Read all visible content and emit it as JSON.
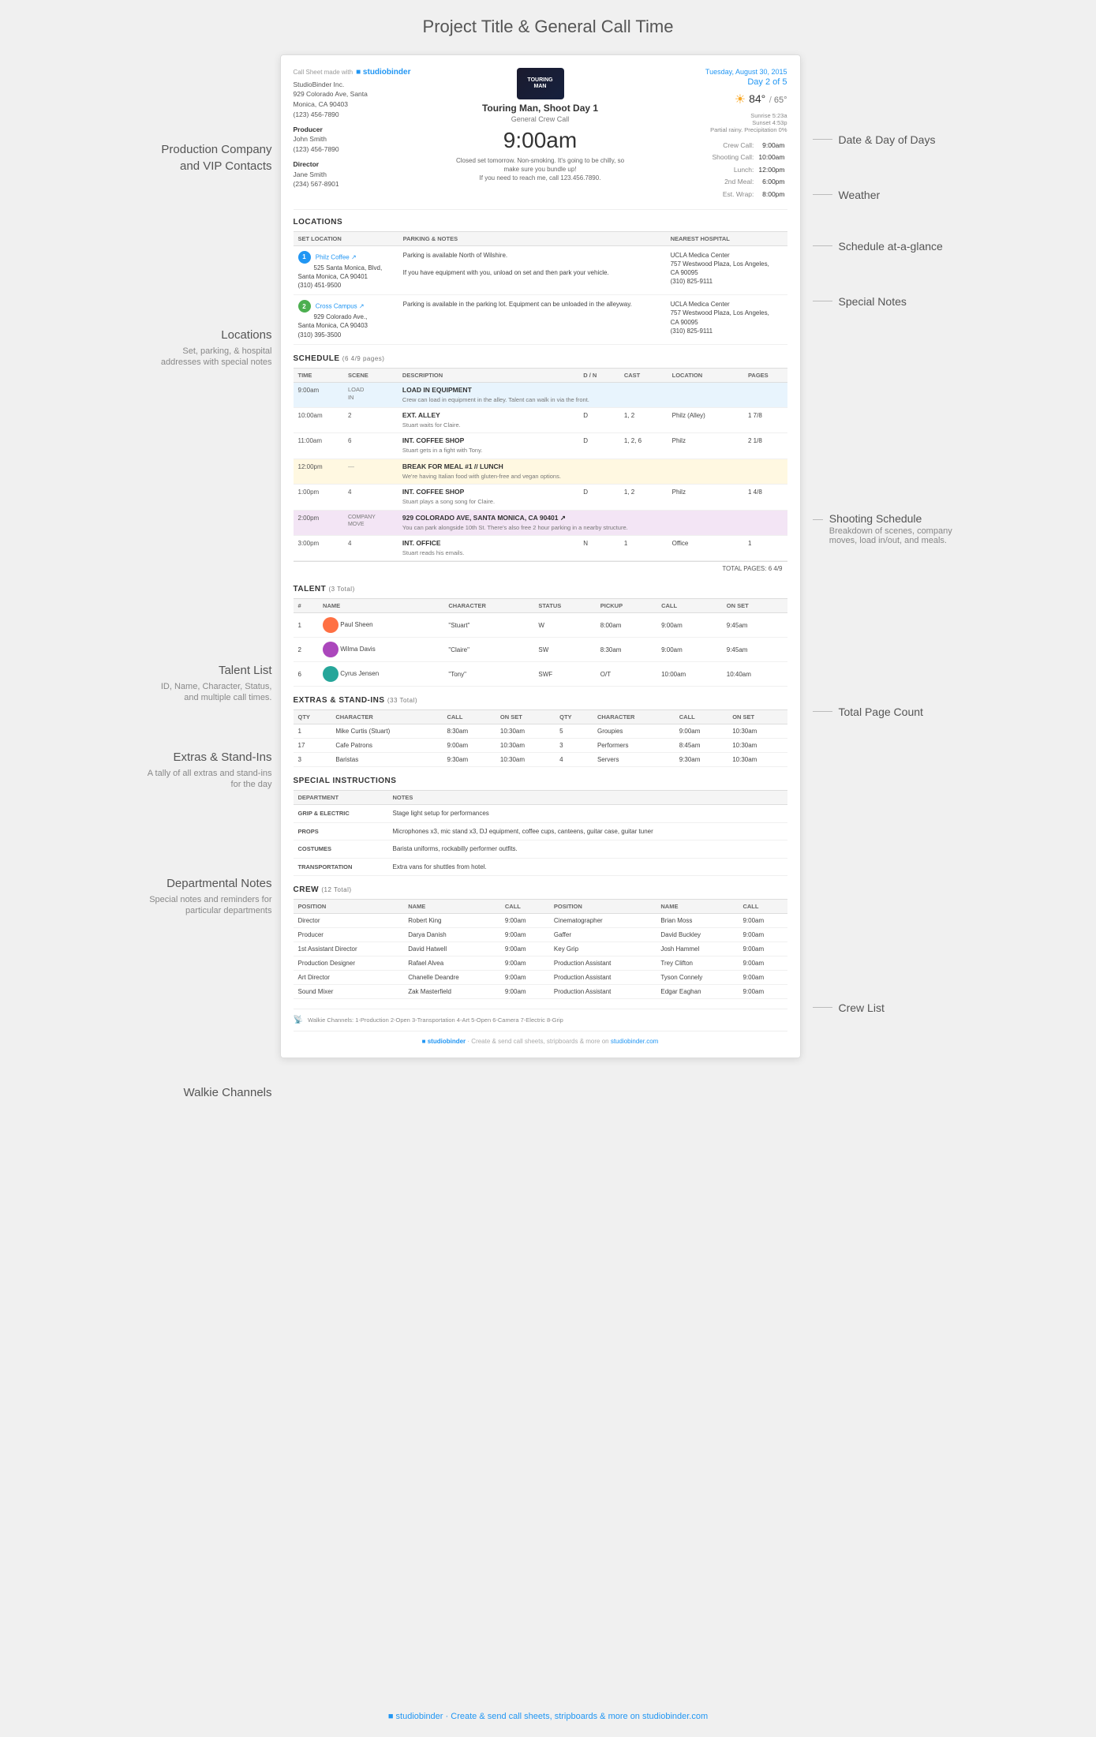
{
  "page": {
    "title": "Project Title & General Call Time",
    "footer": "studiobinder · Create & send call sheets, stripboards & more on studiobinder.com"
  },
  "document": {
    "sb_label": "Call Sheet made with",
    "sb_brand": "studiobinder",
    "company": {
      "name": "StudioBinder Inc.",
      "address1": "929 Colorado Ave, Santa",
      "address2": "Monica, CA 90403",
      "phone": "(123) 456-7890"
    },
    "producer": {
      "label": "Producer",
      "name": "John Smith",
      "phone": "(123) 456-7890"
    },
    "director": {
      "label": "Director",
      "name": "Jane Smith",
      "phone": "(234) 567-8901"
    },
    "tour_logo": "TOURING MAN",
    "show_title": "Touring Man, Shoot Day 1",
    "general_call_label": "General Crew Call",
    "call_time": "9:00am",
    "closed_set_note": "Closed set tomorrow. Non-smoking. It's going to be chilly, so make sure you bundle up!\nIf you need to reach me, call 123.456.7890.",
    "date": "Tuesday, August 30, 2015",
    "day_of_days": "Day 2 of 5",
    "weather": {
      "temp_high": "84°",
      "temp_low": "65°",
      "sunrise": "Sunrise 5:23a",
      "sunset": "Sunset 4:53p",
      "precip": "Partial rainy. Precipitation 0%"
    },
    "schedule_glance": [
      {
        "label": "Crew Call:",
        "time": "9:00am"
      },
      {
        "label": "Shooting Call:",
        "time": "10:00am"
      },
      {
        "label": "Lunch:",
        "time": "12:00pm"
      },
      {
        "label": "2nd Meal:",
        "time": "6:00pm"
      },
      {
        "label": "Est. Wrap:",
        "time": "8:00pm"
      }
    ],
    "locations": {
      "section_title": "LOCATIONS",
      "headers": [
        "SET LOCATION",
        "PARKING & NOTES",
        "NEAREST HOSPITAL"
      ],
      "rows": [
        {
          "number": "1",
          "name": "Philz Coffee",
          "address": "525 Santa Monica, Blvd, Santa Monica, CA 90401\n(310) 451-9500",
          "parking": "Parking is available North of Wilshire.\n\nIf you have equipment with you, unload on set and then park your vehicle.",
          "hospital": "UCLA Medica Center\n757 Westwood Plaza, Los Angeles, CA 90095\n(310) 825-9111"
        },
        {
          "number": "2",
          "name": "Cross Campus",
          "address": "929 Colorado Ave., Santa Monica, CA 90403\n(310) 395-3500",
          "parking": "Parking is available in the parking lot. Equipment can be unloaded in the alleyway.",
          "hospital": "UCLA Medica Center\n757 Westwood Plaza, Los Angeles, CA 90095\n(310) 825-9111"
        }
      ]
    },
    "schedule": {
      "section_title": "SCHEDULE",
      "subtitle": "(6 4/9 pages)",
      "headers": [
        "TIME",
        "SCENE",
        "DESCRIPTION",
        "D/N",
        "CAST",
        "LOCATION",
        "PAGES"
      ],
      "rows": [
        {
          "time": "9:00am",
          "scene": "LOAD IN",
          "title": "LOAD IN EQUIPMENT",
          "desc": "Crew can load in equipment in the alley. Talent can walk in via the front.",
          "dn": "",
          "cast": "",
          "location": "",
          "pages": "",
          "type": "load"
        },
        {
          "time": "10:00am",
          "scene": "2",
          "title": "EXT. ALLEY",
          "desc": "Stuart waits for Claire.",
          "dn": "D",
          "cast": "1, 2",
          "location": "Philz (Alley)",
          "pages": "1 7/8",
          "type": "normal"
        },
        {
          "time": "11:00am",
          "scene": "6",
          "title": "INT. COFFEE SHOP",
          "desc": "Stuart gets in a fight with Tony.",
          "dn": "D",
          "cast": "1, 2, 6",
          "location": "Philz",
          "pages": "2 1/8",
          "type": "normal"
        },
        {
          "time": "12:00pm",
          "scene": "—",
          "title": "BREAK FOR MEAL #1 // LUNCH",
          "desc": "We're having Italian food with gluten-free and vegan options.",
          "dn": "",
          "cast": "",
          "location": "",
          "pages": "",
          "type": "meal"
        },
        {
          "time": "1:00pm",
          "scene": "4",
          "title": "INT. COFFEE SHOP",
          "desc": "Stuart plays a song song for Claire.",
          "dn": "D",
          "cast": "1, 2",
          "location": "Philz",
          "pages": "1 4/8",
          "type": "normal"
        },
        {
          "time": "2:00pm",
          "scene": "COMPANY MOVE",
          "title": "929 COLORADO AVE, SANTA MONICA, CA 90401",
          "desc": "You can park alongside 10th St. There's also free 2 hour parking in a nearby structure.",
          "dn": "",
          "cast": "",
          "location": "",
          "pages": "",
          "type": "move"
        },
        {
          "time": "3:00pm",
          "scene": "4",
          "title": "INT. OFFICE",
          "desc": "Stuart reads his emails.",
          "dn": "N",
          "cast": "1",
          "location": "Office",
          "pages": "1",
          "type": "normal"
        }
      ],
      "total_pages": "TOTAL PAGES: 6 4/9"
    },
    "talent": {
      "section_title": "TALENT",
      "subtitle": "(3 Total)",
      "headers": [
        "#",
        "NAME",
        "CHARACTER",
        "STATUS",
        "PICKUP",
        "CALL",
        "ON SET"
      ],
      "rows": [
        {
          "num": "1",
          "name": "Paul Sheen",
          "character": "\"Stuart\"",
          "status": "W",
          "pickup": "8:00am",
          "call": "9:00am",
          "onset": "9:45am",
          "avatar": "1"
        },
        {
          "num": "2",
          "name": "Wilma Davis",
          "character": "\"Claire\"",
          "status": "SW",
          "pickup": "8:30am",
          "call": "9:00am",
          "onset": "9:45am",
          "avatar": "2"
        },
        {
          "num": "6",
          "name": "Cyrus Jensen",
          "character": "\"Tony\"",
          "status": "SWF",
          "pickup": "O/T",
          "call": "10:00am",
          "onset": "10:40am",
          "avatar": "3"
        }
      ]
    },
    "extras": {
      "section_title": "EXTRAS & STAND-INS",
      "subtitle": "(33 Total)",
      "headers": [
        "QTY",
        "CHARACTER",
        "CALL",
        "ON SET",
        "QTY",
        "CHARACTER",
        "CALL",
        "ON SET"
      ],
      "rows": [
        {
          "qty1": "1",
          "char1": "Mike Curtis (Stuart)",
          "call1": "8:30am",
          "onset1": "10:30am",
          "qty2": "5",
          "char2": "Groupies",
          "call2": "9:00am",
          "onset2": "10:30am"
        },
        {
          "qty1": "17",
          "char1": "Cafe Patrons",
          "call1": "9:00am",
          "onset1": "10:30am",
          "qty2": "3",
          "char2": "Performers",
          "call2": "8:45am",
          "onset2": "10:30am"
        },
        {
          "qty1": "3",
          "char1": "Baristas",
          "call1": "9:30am",
          "onset1": "10:30am",
          "qty2": "4",
          "char2": "Servers",
          "call2": "9:30am",
          "onset2": "10:30am"
        }
      ]
    },
    "special_instructions": {
      "section_title": "SPECIAL INSTRUCTIONS",
      "headers": [
        "DEPARTMENT",
        "NOTES"
      ],
      "rows": [
        {
          "dept": "GRIP & ELECTRIC",
          "notes": "Stage light setup for performances"
        },
        {
          "dept": "PROPS",
          "notes": "Microphones x3, mic stand x3, DJ equipment, coffee cups, canteens, guitar case, guitar tuner"
        },
        {
          "dept": "COSTUMES",
          "notes": "Barista uniforms, rockabilly performer outfits."
        },
        {
          "dept": "TRANSPORTATION",
          "notes": "Extra vans for shuttles from hotel."
        }
      ]
    },
    "crew": {
      "section_title": "CREW",
      "subtitle": "(12 Total)",
      "headers": [
        "POSITION",
        "NAME",
        "CALL",
        "POSITION",
        "NAME",
        "CALL"
      ],
      "rows": [
        {
          "pos1": "Director",
          "name1": "Robert King",
          "call1": "9:00am",
          "pos2": "Cinematographer",
          "name2": "Brian Moss",
          "call2": "9:00am"
        },
        {
          "pos1": "Producer",
          "name1": "Darya Danish",
          "call1": "9:00am",
          "pos2": "Gaffer",
          "name2": "David Buckley",
          "call2": "9:00am"
        },
        {
          "pos1": "1st Assistant Director",
          "name1": "David Hatwell",
          "call1": "9:00am",
          "pos2": "Key Grip",
          "name2": "Josh Hammel",
          "call2": "9:00am"
        },
        {
          "pos1": "Production Designer",
          "name1": "Rafael Alvea",
          "call1": "9:00am",
          "pos2": "Production Assistant",
          "name2": "Trey Clifton",
          "call2": "9:00am"
        },
        {
          "pos1": "Art Director",
          "name1": "Chanelle Deandre",
          "call1": "9:00am",
          "pos2": "Production Assistant",
          "name2": "Tyson Connely",
          "call2": "9:00am"
        },
        {
          "pos1": "Sound Mixer",
          "name1": "Zak Masterfield",
          "call1": "9:00am",
          "pos2": "Production Assistant",
          "name2": "Edgar Eaghan",
          "call2": "9:00am"
        }
      ]
    },
    "walkie": {
      "label": "Walkie Channels:",
      "channels": "1-Production  2-Open  3-Transportation  4-Art  5-Open  6-Camera  7-Electric  8-Grip"
    }
  },
  "left_labels": {
    "production_company": {
      "title": "Production Company",
      "subtitle": "and VIP Contacts"
    },
    "locations": {
      "title": "Locations",
      "subtitle": "Set, parking, & hospital\naddresses with special notes"
    },
    "talent": {
      "title": "Talent List",
      "subtitle": "ID, Name, Character, Status,\nand multiple call times."
    },
    "extras": {
      "title": "Extras & Stand-Ins",
      "subtitle": "A tally of all extras and\nstand-ins for the day"
    },
    "departmental": {
      "title": "Departmental Notes",
      "subtitle": "Special notes and reminders\nfor particular departments"
    },
    "walkie": {
      "title": "Walkie Channels"
    }
  },
  "right_labels": {
    "date_day": {
      "title": "Date & Day of Days"
    },
    "weather": {
      "title": "Weather"
    },
    "schedule_glance": {
      "title": "Schedule at-a-glance"
    },
    "special_notes": {
      "title": "Special Notes"
    },
    "shooting_schedule": {
      "title": "Shooting Schedule",
      "subtitle": "Breakdown of scenes, company\nmoves, load in/out, and meals."
    },
    "total_pages": {
      "title": "Total Page Count"
    },
    "crew_list": {
      "title": "Crew List"
    }
  }
}
